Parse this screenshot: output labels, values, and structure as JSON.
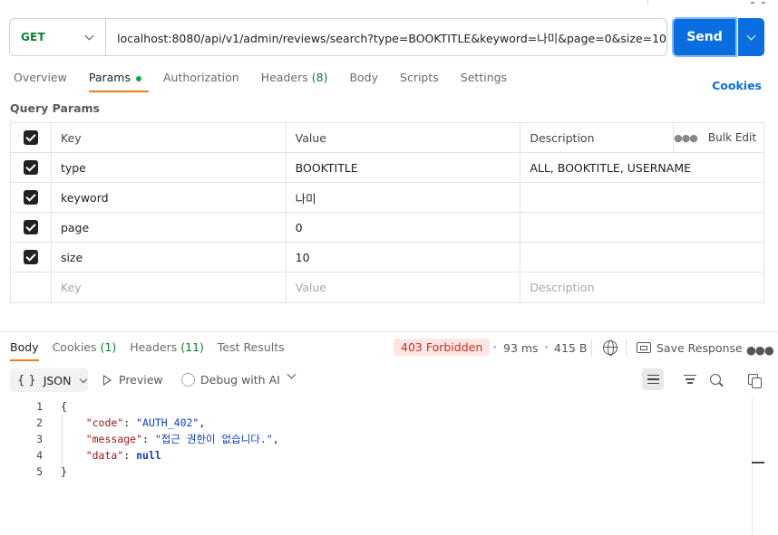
{
  "request": {
    "method": "GET",
    "url": "localhost:8080/api/v1/admin/reviews/search?type=BOOKTITLE&keyword=나미&page=0&size=10",
    "send_label": "Send"
  },
  "request_tabs": {
    "overview": "Overview",
    "params": "Params",
    "authorization": "Authorization",
    "headers": "Headers",
    "headers_count": "(8)",
    "body": "Body",
    "scripts": "Scripts",
    "settings": "Settings",
    "cookies": "Cookies"
  },
  "query_params": {
    "title": "Query Params",
    "columns": {
      "key": "Key",
      "value": "Value",
      "description": "Description",
      "bulk_edit": "Bulk Edit"
    },
    "rows": [
      {
        "key": "type",
        "value": "BOOKTITLE",
        "description": "ALL, BOOKTITLE, USERNAME",
        "checked": true
      },
      {
        "key": "keyword",
        "value": "나미",
        "description": "",
        "checked": true
      },
      {
        "key": "page",
        "value": "0",
        "description": "",
        "checked": true
      },
      {
        "key": "size",
        "value": "10",
        "description": "",
        "checked": true
      }
    ],
    "placeholders": {
      "key": "Key",
      "value": "Value",
      "description": "Description"
    }
  },
  "response": {
    "tabs": {
      "body": "Body",
      "cookies": "Cookies",
      "cookies_count": "(1)",
      "headers": "Headers",
      "headers_count": "(11)",
      "test_results": "Test Results"
    },
    "status": "403 Forbidden",
    "time": "93 ms",
    "size": "415 B",
    "save_response": "Save Response",
    "format": "JSON",
    "preview": "Preview",
    "debug_ai": "Debug with AI",
    "lines": [
      {
        "n": "1",
        "text": "{"
      },
      {
        "n": "2",
        "key": "\"code\"",
        "val": "\"AUTH_402\"",
        "tail": ","
      },
      {
        "n": "3",
        "key": "\"message\"",
        "val": "\"접근 권한이 없습니다.\"",
        "tail": ","
      },
      {
        "n": "4",
        "key": "\"data\"",
        "val": "null",
        "tail": ""
      },
      {
        "n": "5",
        "text": "}"
      }
    ]
  },
  "colors": {
    "accent": "#0b6ee0",
    "method_get": "#0a7c2f",
    "tab_active": "#f07d1a",
    "status_error": "#c72f1f"
  }
}
